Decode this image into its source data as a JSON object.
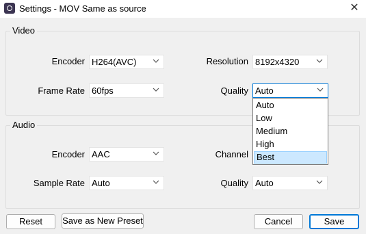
{
  "window": {
    "title": "Settings - MOV Same as source",
    "close_glyph": "✕"
  },
  "video": {
    "group_label": "Video",
    "encoder_label": "Encoder",
    "encoder_value": "H264(AVC)",
    "resolution_label": "Resolution",
    "resolution_value": "8192x4320",
    "frame_rate_label": "Frame Rate",
    "frame_rate_value": "60fps",
    "quality_label": "Quality",
    "quality_value": "Auto",
    "quality_options": [
      "Auto",
      "Low",
      "Medium",
      "High",
      "Best"
    ],
    "quality_highlighted": "Best"
  },
  "audio": {
    "group_label": "Audio",
    "encoder_label": "Encoder",
    "encoder_value": "AAC",
    "channel_label": "Channel",
    "sample_rate_label": "Sample Rate",
    "sample_rate_value": "Auto",
    "quality_label": "Quality",
    "quality_value": "Auto"
  },
  "buttons": {
    "reset": "Reset",
    "save_preset": "Save as New Preset",
    "cancel": "Cancel",
    "save": "Save"
  },
  "colors": {
    "accent": "#0078d7",
    "highlight": "#cce8ff"
  }
}
